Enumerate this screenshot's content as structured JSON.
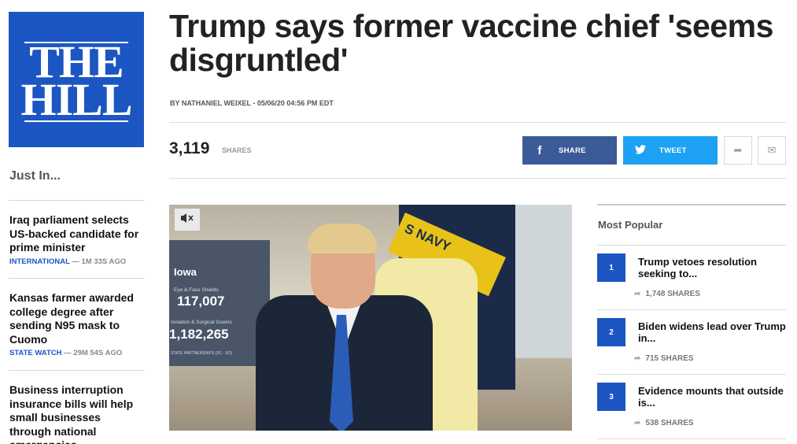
{
  "logo": {
    "line1": "THE",
    "line2": "HILL"
  },
  "just_in": {
    "title": "Just In...",
    "items": [
      {
        "headline": "Iraq parliament selects US-backed candidate for prime minister",
        "category": "INTERNATIONAL",
        "time": "1M 33S AGO"
      },
      {
        "headline": "Kansas farmer awarded college degree after sending N95 mask to Cuomo",
        "category": "STATE WATCH",
        "time": "29M 54S AGO"
      },
      {
        "headline": "Business interruption insurance bills will help small businesses through national emergencies",
        "category": "",
        "time": ""
      }
    ]
  },
  "article": {
    "headline": "Trump says former vaccine chief 'seems disgruntled'",
    "byline": "BY NATHANIEL WEIXEL - 05/06/20 04:56 PM EDT",
    "shares_count": "3,119",
    "shares_label": "SHARES"
  },
  "share_buttons": {
    "facebook": {
      "icon": "facebook-icon",
      "label": "SHARE"
    },
    "twitter": {
      "icon": "twitter-icon",
      "label": "TWEET"
    },
    "more": {
      "icon": "share-arrow-icon"
    },
    "email": {
      "icon": "mail-icon"
    }
  },
  "video": {
    "mute_icon": "mute-icon",
    "panel": {
      "title": "Iowa",
      "label1": "Eye & Face Shields",
      "value1": "117,007",
      "label2": "Isolation & Surgical Gowns",
      "value2": "1,182,265",
      "footer": "STATE PARTNERSHIPS (3/1 - 5/1)"
    },
    "flag_text": "S NAVY"
  },
  "most_popular": {
    "title": "Most Popular",
    "items": [
      {
        "rank": "1",
        "headline": "Trump vetoes resolution seeking to...",
        "shares": "1,748 SHARES"
      },
      {
        "rank": "2",
        "headline": "Biden widens lead over Trump in...",
        "shares": "715 SHARES"
      },
      {
        "rank": "3",
        "headline": "Evidence mounts that outside is...",
        "shares": "538 SHARES"
      }
    ]
  },
  "colors": {
    "brand_blue": "#1b56c2",
    "facebook": "#3b5a98",
    "twitter": "#1da1f2"
  }
}
